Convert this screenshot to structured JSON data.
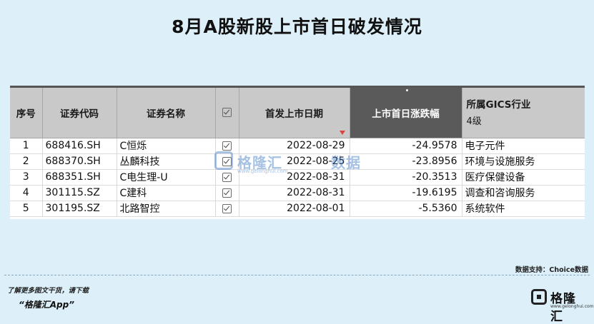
{
  "title": "8月A股新股上市首日破发情况",
  "table": {
    "headers": {
      "no": "序号",
      "code": "证券代码",
      "name": "证券名称",
      "date": "首发上市日期",
      "change": "上市首日涨跌幅",
      "industry": "所属GICS行业",
      "industry_level": "4级"
    },
    "rows": [
      {
        "no": "1",
        "code": "688416.SH",
        "name": "C恒烁",
        "date": "2022-08-29",
        "change": "-24.9578",
        "industry": "电子元件"
      },
      {
        "no": "2",
        "code": "688370.SH",
        "name": "丛麟科技",
        "date": "2022-08-25",
        "change": "-23.8956",
        "industry": "环境与设施服务"
      },
      {
        "no": "3",
        "code": "688351.SH",
        "name": "C电生理-U",
        "date": "2022-08-31",
        "change": "-20.3513",
        "industry": "医疗保健设备"
      },
      {
        "no": "4",
        "code": "301115.SZ",
        "name": "C建科",
        "date": "2022-08-31",
        "change": "-19.6195",
        "industry": "调查和咨询服务"
      },
      {
        "no": "5",
        "code": "301195.SZ",
        "name": "北路智控",
        "date": "2022-08-01",
        "change": "-5.5360",
        "industry": "系统软件"
      }
    ]
  },
  "watermark": {
    "brand": "格隆汇",
    "data_word": "数据",
    "url": "www.gelonghui.com"
  },
  "footer": {
    "source": "数据支持：Choice数据",
    "download_hint": "了解更多图文干货，请下载",
    "app_name": "“格隆汇App”",
    "brand": "格隆汇"
  },
  "icons": {
    "checkbox": "checkbox-checked-icon",
    "filter": "filter-triangle-icon",
    "logo": "gelonghui-logo-icon"
  },
  "colors": {
    "background": "#ddf0fa",
    "header": "#c9c9c9",
    "active_header": "#5a5a5a",
    "filter_mark": "#e0413c"
  }
}
